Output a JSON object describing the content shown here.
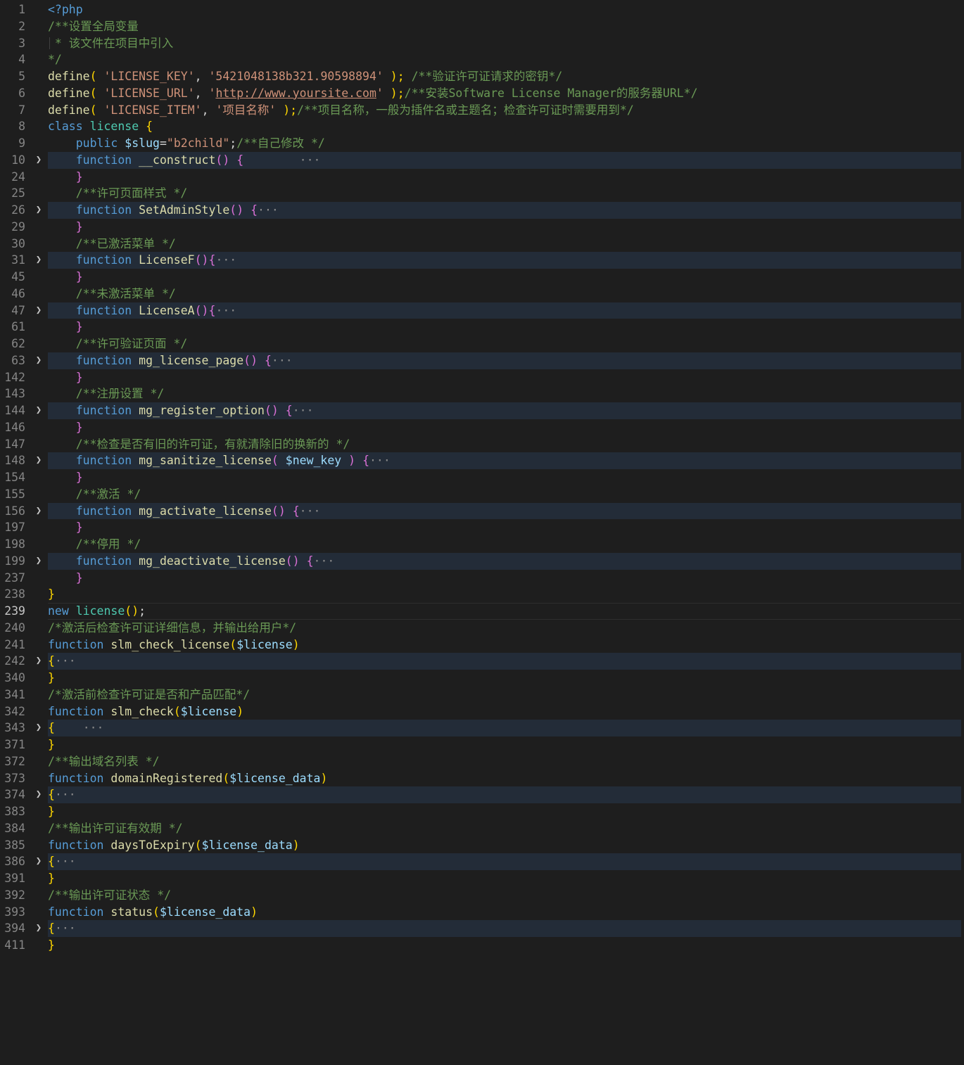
{
  "colors": {
    "background": "#1e1e1e",
    "folded_highlight": "#232c38",
    "line_number": "#858585",
    "line_number_active": "#c6c6c6",
    "keyword": "#569cd6",
    "control": "#c586c0",
    "function_name": "#dcdcaa",
    "class_name": "#4ec9b0",
    "variable": "#9cdcfe",
    "string": "#ce9178",
    "comment": "#6a9955",
    "bracket_gold": "#ffd700",
    "bracket_pink": "#da70d6",
    "bracket_blue": "#179fff",
    "plain": "#d4d4d4"
  },
  "icons": {
    "fold": "chevron-right-icon",
    "ellipsis": "folded-region-ellipsis"
  },
  "lines": [
    {
      "n": "1",
      "tokens": [
        {
          "t": "<?php",
          "c": "keyword"
        }
      ]
    },
    {
      "n": "2",
      "tokens": [
        {
          "t": "/**设置全局变量",
          "c": "comment"
        }
      ]
    },
    {
      "n": "3",
      "tokens": [
        {
          "t": " * 该文件在项目中引入",
          "c": "comment"
        }
      ]
    },
    {
      "n": "4",
      "tokens": [
        {
          "t": "*/",
          "c": "comment"
        }
      ]
    },
    {
      "n": "5",
      "tokens": [
        {
          "t": "define",
          "c": "function_name"
        },
        {
          "t": "( ",
          "c": "bracket_gold"
        },
        {
          "t": "'LICENSE_KEY'",
          "c": "string"
        },
        {
          "t": ", ",
          "c": "plain"
        },
        {
          "t": "'5421048138b321.90598894'",
          "c": "string"
        },
        {
          "t": " );",
          "c": "bracket_gold"
        },
        {
          "t": " /**验证许可证请求的密钥*/",
          "c": "comment"
        }
      ]
    },
    {
      "n": "6",
      "tokens": [
        {
          "t": "define",
          "c": "function_name"
        },
        {
          "t": "( ",
          "c": "bracket_gold"
        },
        {
          "t": "'LICENSE_URL'",
          "c": "string"
        },
        {
          "t": ", ",
          "c": "plain"
        },
        {
          "t": "'",
          "c": "string"
        },
        {
          "t": "http://www.yoursite.com",
          "c": "string",
          "u": true
        },
        {
          "t": "'",
          "c": "string"
        },
        {
          "t": " );",
          "c": "bracket_gold"
        },
        {
          "t": "/**安装Software License Manager的服务器URL*/",
          "c": "comment"
        }
      ]
    },
    {
      "n": "7",
      "tokens": [
        {
          "t": "define",
          "c": "function_name"
        },
        {
          "t": "( ",
          "c": "bracket_gold"
        },
        {
          "t": "'LICENSE_ITEM'",
          "c": "string"
        },
        {
          "t": ", ",
          "c": "plain"
        },
        {
          "t": "'项目名称'",
          "c": "string"
        },
        {
          "t": " );",
          "c": "bracket_gold"
        },
        {
          "t": "/**项目名称，一般为插件名或主题名；检查许可证时需要用到*/",
          "c": "comment"
        }
      ]
    },
    {
      "n": "8",
      "tokens": [
        {
          "t": "class ",
          "c": "keyword"
        },
        {
          "t": "license ",
          "c": "class_name"
        },
        {
          "t": "{",
          "c": "bracket_gold"
        }
      ]
    },
    {
      "n": "9",
      "tokens": [
        {
          "t": "    public ",
          "c": "keyword"
        },
        {
          "t": "$slug",
          "c": "variable"
        },
        {
          "t": "=",
          "c": "plain"
        },
        {
          "t": "\"b2child\"",
          "c": "string"
        },
        {
          "t": ";",
          "c": "plain"
        },
        {
          "t": "/**自己修改 */",
          "c": "comment"
        }
      ]
    },
    {
      "n": "10",
      "fold": true,
      "tokens": [
        {
          "t": "    function ",
          "c": "keyword"
        },
        {
          "t": "__construct",
          "c": "function_name"
        },
        {
          "t": "() ",
          "c": "bracket_pink"
        },
        {
          "t": "{",
          "c": "bracket_pink"
        },
        {
          "t": "        ",
          "c": "plain"
        },
        {
          "t": "···",
          "c": "ellipsis"
        }
      ]
    },
    {
      "n": "24",
      "tokens": [
        {
          "t": "    }",
          "c": "bracket_pink"
        }
      ]
    },
    {
      "n": "25",
      "tokens": [
        {
          "t": "    /**许可页面样式 */",
          "c": "comment"
        }
      ]
    },
    {
      "n": "26",
      "fold": true,
      "tokens": [
        {
          "t": "    function ",
          "c": "keyword"
        },
        {
          "t": "SetAdminStyle",
          "c": "function_name"
        },
        {
          "t": "() ",
          "c": "bracket_pink"
        },
        {
          "t": "{",
          "c": "bracket_pink"
        },
        {
          "t": "···",
          "c": "ellipsis"
        }
      ]
    },
    {
      "n": "29",
      "tokens": [
        {
          "t": "    }",
          "c": "bracket_pink"
        }
      ]
    },
    {
      "n": "30",
      "tokens": [
        {
          "t": "    /**已激活菜单 */",
          "c": "comment"
        }
      ]
    },
    {
      "n": "31",
      "fold": true,
      "tokens": [
        {
          "t": "    function ",
          "c": "keyword"
        },
        {
          "t": "LicenseF",
          "c": "function_name"
        },
        {
          "t": "()",
          "c": "bracket_pink"
        },
        {
          "t": "{",
          "c": "bracket_pink"
        },
        {
          "t": "···",
          "c": "ellipsis"
        }
      ]
    },
    {
      "n": "45",
      "tokens": [
        {
          "t": "    }",
          "c": "bracket_pink"
        }
      ]
    },
    {
      "n": "46",
      "tokens": [
        {
          "t": "    /**未激活菜单 */",
          "c": "comment"
        }
      ]
    },
    {
      "n": "47",
      "fold": true,
      "tokens": [
        {
          "t": "    function ",
          "c": "keyword"
        },
        {
          "t": "LicenseA",
          "c": "function_name"
        },
        {
          "t": "()",
          "c": "bracket_pink"
        },
        {
          "t": "{",
          "c": "bracket_pink"
        },
        {
          "t": "···",
          "c": "ellipsis"
        }
      ]
    },
    {
      "n": "61",
      "tokens": [
        {
          "t": "    }",
          "c": "bracket_pink"
        }
      ]
    },
    {
      "n": "62",
      "tokens": [
        {
          "t": "    /**许可验证页面 */",
          "c": "comment"
        }
      ]
    },
    {
      "n": "63",
      "fold": true,
      "tokens": [
        {
          "t": "    function ",
          "c": "keyword"
        },
        {
          "t": "mg_license_page",
          "c": "function_name"
        },
        {
          "t": "() ",
          "c": "bracket_pink"
        },
        {
          "t": "{",
          "c": "bracket_pink"
        },
        {
          "t": "···",
          "c": "ellipsis"
        }
      ]
    },
    {
      "n": "142",
      "tokens": [
        {
          "t": "    }",
          "c": "bracket_pink"
        }
      ]
    },
    {
      "n": "143",
      "tokens": [
        {
          "t": "    /**注册设置 */",
          "c": "comment"
        }
      ]
    },
    {
      "n": "144",
      "fold": true,
      "tokens": [
        {
          "t": "    function ",
          "c": "keyword"
        },
        {
          "t": "mg_register_option",
          "c": "function_name"
        },
        {
          "t": "() ",
          "c": "bracket_pink"
        },
        {
          "t": "{",
          "c": "bracket_pink"
        },
        {
          "t": "···",
          "c": "ellipsis"
        }
      ]
    },
    {
      "n": "146",
      "tokens": [
        {
          "t": "    }",
          "c": "bracket_pink"
        }
      ]
    },
    {
      "n": "147",
      "tokens": [
        {
          "t": "    /**检查是否有旧的许可证，有就清除旧的换新的 */",
          "c": "comment"
        }
      ]
    },
    {
      "n": "148",
      "fold": true,
      "tokens": [
        {
          "t": "    function ",
          "c": "keyword"
        },
        {
          "t": "mg_sanitize_license",
          "c": "function_name"
        },
        {
          "t": "( ",
          "c": "bracket_pink"
        },
        {
          "t": "$new_key",
          "c": "variable"
        },
        {
          "t": " ) ",
          "c": "bracket_pink"
        },
        {
          "t": "{",
          "c": "bracket_pink"
        },
        {
          "t": "···",
          "c": "ellipsis"
        }
      ]
    },
    {
      "n": "154",
      "tokens": [
        {
          "t": "    }",
          "c": "bracket_pink"
        }
      ]
    },
    {
      "n": "155",
      "tokens": [
        {
          "t": "    /**激活 */",
          "c": "comment"
        }
      ]
    },
    {
      "n": "156",
      "fold": true,
      "tokens": [
        {
          "t": "    function ",
          "c": "keyword"
        },
        {
          "t": "mg_activate_license",
          "c": "function_name"
        },
        {
          "t": "() ",
          "c": "bracket_pink"
        },
        {
          "t": "{",
          "c": "bracket_pink"
        },
        {
          "t": "···",
          "c": "ellipsis"
        }
      ]
    },
    {
      "n": "197",
      "tokens": [
        {
          "t": "    }",
          "c": "bracket_pink"
        }
      ]
    },
    {
      "n": "198",
      "tokens": [
        {
          "t": "    /**停用 */",
          "c": "comment"
        }
      ]
    },
    {
      "n": "199",
      "fold": true,
      "tokens": [
        {
          "t": "    function ",
          "c": "keyword"
        },
        {
          "t": "mg_deactivate_license",
          "c": "function_name"
        },
        {
          "t": "() ",
          "c": "bracket_pink"
        },
        {
          "t": "{",
          "c": "bracket_pink"
        },
        {
          "t": "···",
          "c": "ellipsis"
        }
      ]
    },
    {
      "n": "237",
      "tokens": [
        {
          "t": "    }",
          "c": "bracket_pink"
        }
      ]
    },
    {
      "n": "238",
      "tokens": [
        {
          "t": "}",
          "c": "bracket_gold"
        }
      ]
    },
    {
      "n": "239",
      "current": true,
      "tokens": [
        {
          "t": "new ",
          "c": "keyword"
        },
        {
          "t": "license",
          "c": "class_name"
        },
        {
          "t": "()",
          "c": "bracket_gold"
        },
        {
          "t": ";",
          "c": "plain"
        }
      ]
    },
    {
      "n": "240",
      "tokens": [
        {
          "t": "/*激活后检查许可证详细信息，并输出给用户*/",
          "c": "comment"
        }
      ]
    },
    {
      "n": "241",
      "tokens": [
        {
          "t": "function ",
          "c": "keyword"
        },
        {
          "t": "slm_check_license",
          "c": "function_name"
        },
        {
          "t": "(",
          "c": "bracket_gold"
        },
        {
          "t": "$license",
          "c": "variable"
        },
        {
          "t": ")",
          "c": "bracket_gold"
        }
      ]
    },
    {
      "n": "242",
      "fold": true,
      "tokens": [
        {
          "t": "{",
          "c": "bracket_gold"
        },
        {
          "t": "···",
          "c": "ellipsis"
        }
      ]
    },
    {
      "n": "340",
      "tokens": [
        {
          "t": "}",
          "c": "bracket_gold"
        }
      ]
    },
    {
      "n": "341",
      "tokens": [
        {
          "t": "/*激活前检查许可证是否和产品匹配*/",
          "c": "comment"
        }
      ]
    },
    {
      "n": "342",
      "tokens": [
        {
          "t": "function ",
          "c": "keyword"
        },
        {
          "t": "slm_check",
          "c": "function_name"
        },
        {
          "t": "(",
          "c": "bracket_gold"
        },
        {
          "t": "$license",
          "c": "variable"
        },
        {
          "t": ")",
          "c": "bracket_gold"
        }
      ]
    },
    {
      "n": "343",
      "fold": true,
      "tokens": [
        {
          "t": "{",
          "c": "bracket_gold"
        },
        {
          "t": "    ",
          "c": "plain"
        },
        {
          "t": "···",
          "c": "ellipsis"
        }
      ]
    },
    {
      "n": "371",
      "tokens": [
        {
          "t": "}",
          "c": "bracket_gold"
        }
      ]
    },
    {
      "n": "372",
      "tokens": [
        {
          "t": "/**输出域名列表 */",
          "c": "comment"
        }
      ]
    },
    {
      "n": "373",
      "tokens": [
        {
          "t": "function ",
          "c": "keyword"
        },
        {
          "t": "domainRegistered",
          "c": "function_name"
        },
        {
          "t": "(",
          "c": "bracket_gold"
        },
        {
          "t": "$license_data",
          "c": "variable"
        },
        {
          "t": ")",
          "c": "bracket_gold"
        }
      ]
    },
    {
      "n": "374",
      "fold": true,
      "tokens": [
        {
          "t": "{",
          "c": "bracket_gold"
        },
        {
          "t": "···",
          "c": "ellipsis"
        }
      ]
    },
    {
      "n": "383",
      "tokens": [
        {
          "t": "}",
          "c": "bracket_gold"
        }
      ]
    },
    {
      "n": "384",
      "tokens": [
        {
          "t": "/**输出许可证有效期 */",
          "c": "comment"
        }
      ]
    },
    {
      "n": "385",
      "tokens": [
        {
          "t": "function ",
          "c": "keyword"
        },
        {
          "t": "daysToExpiry",
          "c": "function_name"
        },
        {
          "t": "(",
          "c": "bracket_gold"
        },
        {
          "t": "$license_data",
          "c": "variable"
        },
        {
          "t": ")",
          "c": "bracket_gold"
        }
      ]
    },
    {
      "n": "386",
      "fold": true,
      "tokens": [
        {
          "t": "{",
          "c": "bracket_gold"
        },
        {
          "t": "···",
          "c": "ellipsis"
        }
      ]
    },
    {
      "n": "391",
      "tokens": [
        {
          "t": "}",
          "c": "bracket_gold"
        }
      ]
    },
    {
      "n": "392",
      "tokens": [
        {
          "t": "/**输出许可证状态 */",
          "c": "comment"
        }
      ]
    },
    {
      "n": "393",
      "tokens": [
        {
          "t": "function ",
          "c": "keyword"
        },
        {
          "t": "status",
          "c": "function_name"
        },
        {
          "t": "(",
          "c": "bracket_gold"
        },
        {
          "t": "$license_data",
          "c": "variable"
        },
        {
          "t": ")",
          "c": "bracket_gold"
        }
      ]
    },
    {
      "n": "394",
      "fold": true,
      "tokens": [
        {
          "t": "{",
          "c": "bracket_gold"
        },
        {
          "t": "···",
          "c": "ellipsis"
        }
      ]
    },
    {
      "n": "411",
      "tokens": [
        {
          "t": "}",
          "c": "bracket_gold"
        }
      ]
    }
  ]
}
